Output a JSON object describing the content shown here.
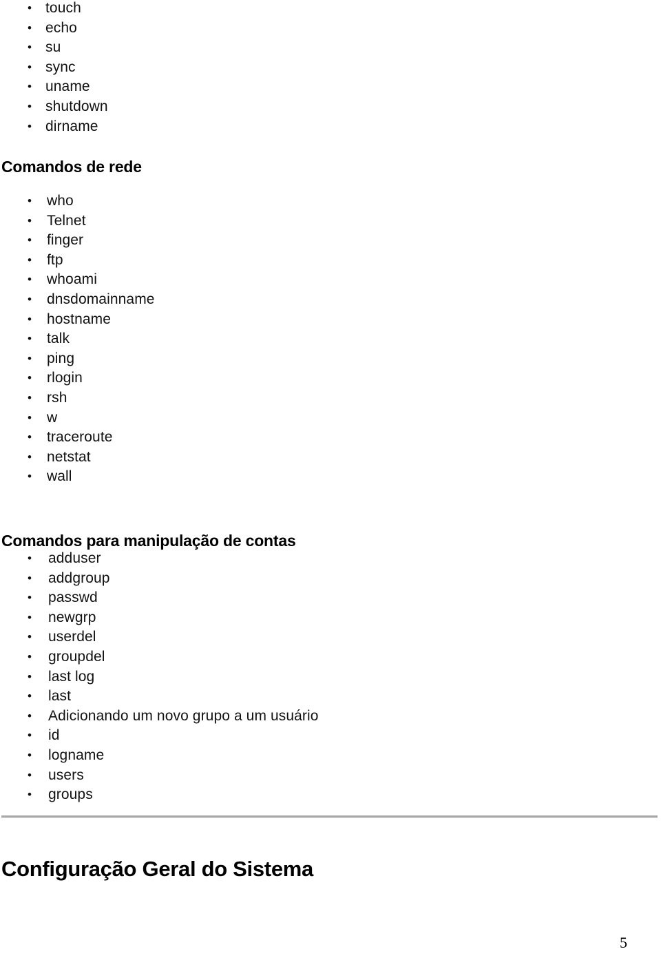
{
  "document": {
    "page_number": "5",
    "bullet_glyph": "•"
  },
  "general_commands": {
    "items": [
      {
        "label": "touch"
      },
      {
        "label": "echo"
      },
      {
        "label": "su"
      },
      {
        "label": "sync"
      },
      {
        "label": "uname"
      },
      {
        "label": "shutdown"
      },
      {
        "label": "dirname"
      }
    ]
  },
  "network_section": {
    "heading": "Comandos de rede",
    "items": [
      {
        "label": "who"
      },
      {
        "label": "Telnet"
      },
      {
        "label": "finger"
      },
      {
        "label": "ftp"
      },
      {
        "label": "whoami"
      },
      {
        "label": "dnsdomainname"
      },
      {
        "label": "hostname"
      },
      {
        "label": "talk"
      },
      {
        "label": "ping"
      },
      {
        "label": "rlogin"
      },
      {
        "label": "rsh"
      },
      {
        "label": "w"
      },
      {
        "label": "traceroute"
      },
      {
        "label": "netstat"
      },
      {
        "label": "wall"
      }
    ]
  },
  "accounts_section": {
    "heading": "Comandos para manipulação de contas",
    "items": [
      {
        "label": "adduser"
      },
      {
        "label": "addgroup"
      },
      {
        "label": "passwd"
      },
      {
        "label": "newgrp"
      },
      {
        "label": "userdel"
      },
      {
        "label": "groupdel"
      },
      {
        "label": "last log"
      },
      {
        "label": "last"
      },
      {
        "label": "Adicionando um novo grupo a um usuário"
      },
      {
        "label": "id"
      },
      {
        "label": "logname"
      },
      {
        "label": "users"
      },
      {
        "label": "groups"
      }
    ]
  },
  "chapter_section": {
    "heading": "Configuração Geral do Sistema"
  }
}
